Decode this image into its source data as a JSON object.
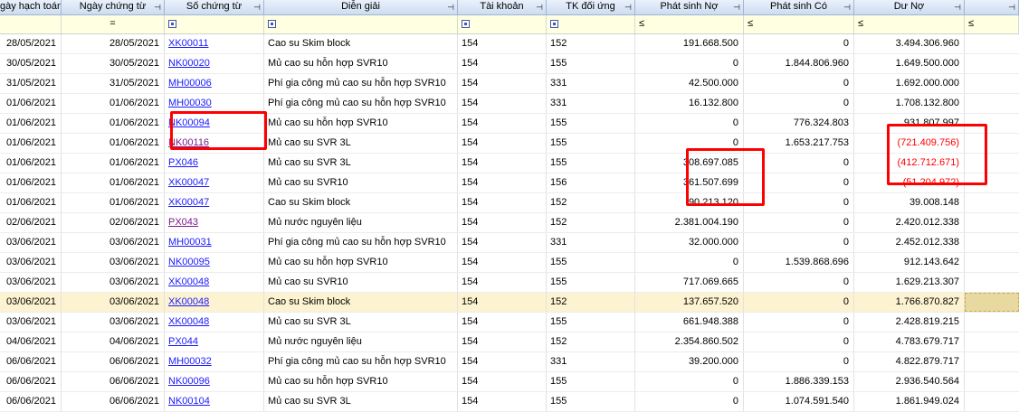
{
  "headers": [
    "gày hạch toán",
    "Ngày chứng từ",
    "Số chứng từ",
    "Diễn giải",
    "Tài khoản",
    "TK đối ứng",
    "Phát sinh Nợ",
    "Phát sinh Có",
    "Dư Nợ"
  ],
  "filter_ops": {
    "c2": "=",
    "c7": "≤",
    "c8": "≤",
    "c9": "≤",
    "c10": "≤"
  },
  "rows": [
    {
      "ngay_ht": "28/05/2021",
      "ngay_ct": "28/05/2021",
      "so_ct": "XK00011",
      "dien_giai": "Cao su Skim block",
      "tk": "154",
      "tk_du": "152",
      "no": "191.668.500",
      "co": "0",
      "du_no": "3.494.306.960"
    },
    {
      "ngay_ht": "30/05/2021",
      "ngay_ct": "30/05/2021",
      "so_ct": "NK00020",
      "dien_giai": "Mủ cao su hỗn hợp SVR10",
      "tk": "154",
      "tk_du": "155",
      "no": "0",
      "co": "1.844.806.960",
      "du_no": "1.649.500.000"
    },
    {
      "ngay_ht": "31/05/2021",
      "ngay_ct": "31/05/2021",
      "so_ct": "MH00006",
      "dien_giai": "Phí gia công mủ cao su hỗn hợp SVR10",
      "tk": "154",
      "tk_du": "331",
      "no": "42.500.000",
      "co": "0",
      "du_no": "1.692.000.000"
    },
    {
      "ngay_ht": "01/06/2021",
      "ngay_ct": "01/06/2021",
      "so_ct": "MH00030",
      "dien_giai": "Phí gia công mủ cao su hỗn hợp SVR10",
      "tk": "154",
      "tk_du": "331",
      "no": "16.132.800",
      "co": "0",
      "du_no": "1.708.132.800"
    },
    {
      "ngay_ht": "01/06/2021",
      "ngay_ct": "01/06/2021",
      "so_ct": "NK00094",
      "dien_giai": "Mủ cao su hỗn hợp SVR10",
      "tk": "154",
      "tk_du": "155",
      "no": "0",
      "co": "776.324.803",
      "du_no": "931.807.997"
    },
    {
      "ngay_ht": "01/06/2021",
      "ngay_ct": "01/06/2021",
      "so_ct": "NK00116",
      "dien_giai": "Mủ cao su SVR 3L",
      "tk": "154",
      "tk_du": "155",
      "no": "0",
      "co": "1.653.217.753",
      "du_no": "(721.409.756)",
      "neg": true,
      "visited": true
    },
    {
      "ngay_ht": "01/06/2021",
      "ngay_ct": "01/06/2021",
      "so_ct": "PX046",
      "dien_giai": "Mủ cao su SVR 3L",
      "tk": "154",
      "tk_du": "155",
      "no": "308.697.085",
      "co": "0",
      "du_no": "(412.712.671)",
      "neg": true
    },
    {
      "ngay_ht": "01/06/2021",
      "ngay_ct": "01/06/2021",
      "so_ct": "XK00047",
      "dien_giai": "Mủ cao su SVR10",
      "tk": "154",
      "tk_du": "156",
      "no": "361.507.699",
      "co": "0",
      "du_no": "(51.204.972)",
      "neg": true
    },
    {
      "ngay_ht": "01/06/2021",
      "ngay_ct": "01/06/2021",
      "so_ct": "XK00047",
      "dien_giai": "Cao su Skim block",
      "tk": "154",
      "tk_du": "152",
      "no": "90.213.120",
      "co": "0",
      "du_no": "39.008.148"
    },
    {
      "ngay_ht": "02/06/2021",
      "ngay_ct": "02/06/2021",
      "so_ct": "PX043",
      "dien_giai": "Mủ nước nguyên liệu",
      "tk": "154",
      "tk_du": "152",
      "no": "2.381.004.190",
      "co": "0",
      "du_no": "2.420.012.338",
      "visited": true
    },
    {
      "ngay_ht": "03/06/2021",
      "ngay_ct": "03/06/2021",
      "so_ct": "MH00031",
      "dien_giai": "Phí gia công mủ cao su hỗn hợp SVR10",
      "tk": "154",
      "tk_du": "331",
      "no": "32.000.000",
      "co": "0",
      "du_no": "2.452.012.338"
    },
    {
      "ngay_ht": "03/06/2021",
      "ngay_ct": "03/06/2021",
      "so_ct": "NK00095",
      "dien_giai": "Mủ cao su hỗn hợp SVR10",
      "tk": "154",
      "tk_du": "155",
      "no": "0",
      "co": "1.539.868.696",
      "du_no": "912.143.642"
    },
    {
      "ngay_ht": "03/06/2021",
      "ngay_ct": "03/06/2021",
      "so_ct": "XK00048",
      "dien_giai": "Mủ cao su SVR10",
      "tk": "154",
      "tk_du": "155",
      "no": "717.069.665",
      "co": "0",
      "du_no": "1.629.213.307"
    },
    {
      "ngay_ht": "03/06/2021",
      "ngay_ct": "03/06/2021",
      "so_ct": "XK00048",
      "dien_giai": "Cao su Skim block",
      "tk": "154",
      "tk_du": "152",
      "no": "137.657.520",
      "co": "0",
      "du_no": "1.766.870.827",
      "selected": true
    },
    {
      "ngay_ht": "03/06/2021",
      "ngay_ct": "03/06/2021",
      "so_ct": "XK00048",
      "dien_giai": "Mủ cao su SVR 3L",
      "tk": "154",
      "tk_du": "155",
      "no": "661.948.388",
      "co": "0",
      "du_no": "2.428.819.215"
    },
    {
      "ngay_ht": "04/06/2021",
      "ngay_ct": "04/06/2021",
      "so_ct": "PX044",
      "dien_giai": "Mủ nước nguyên liệu",
      "tk": "154",
      "tk_du": "152",
      "no": "2.354.860.502",
      "co": "0",
      "du_no": "4.783.679.717"
    },
    {
      "ngay_ht": "06/06/2021",
      "ngay_ct": "06/06/2021",
      "so_ct": "MH00032",
      "dien_giai": "Phí gia công mủ cao su hỗn hợp SVR10",
      "tk": "154",
      "tk_du": "331",
      "no": "39.200.000",
      "co": "0",
      "du_no": "4.822.879.717"
    },
    {
      "ngay_ht": "06/06/2021",
      "ngay_ct": "06/06/2021",
      "so_ct": "NK00096",
      "dien_giai": "Mủ cao su hỗn hợp SVR10",
      "tk": "154",
      "tk_du": "155",
      "no": "0",
      "co": "1.886.339.153",
      "du_no": "2.936.540.564"
    },
    {
      "ngay_ht": "06/06/2021",
      "ngay_ct": "06/06/2021",
      "so_ct": "NK00104",
      "dien_giai": "Mủ cao su SVR 3L",
      "tk": "154",
      "tk_du": "155",
      "no": "0",
      "co": "1.074.591.540",
      "du_no": "1.861.949.024"
    }
  ],
  "colors": {
    "link": "#1a1aff",
    "visited_link": "#7a1a8a",
    "negative": "#ff0000",
    "highlight_box": "#ff0000",
    "selected_row": "#fdf3d0",
    "header_bg": "#cddcf1",
    "filter_bg": "#ffffe1"
  }
}
